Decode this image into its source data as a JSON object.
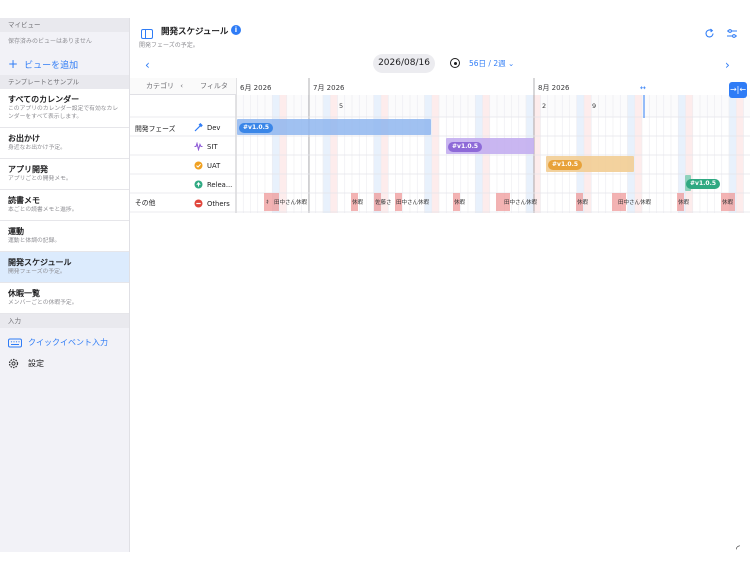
{
  "sidebar": {
    "my_views_header": "マイビュー",
    "no_views": "保存済みのビューはありません",
    "add_view": "ビューを追加",
    "templates_header": "テンプレートとサンプル",
    "items": [
      {
        "title": "すべてのカレンダー",
        "desc": "このアプリのカレンダー設定で有効なカレンダーをすべて表示します。"
      },
      {
        "title": "お出かけ",
        "desc": "身近なお出かけ予定。"
      },
      {
        "title": "アプリ開発",
        "desc": "アプリごとの開発メモ。"
      },
      {
        "title": "読書メモ",
        "desc": "本ごとの読書メモと進捗。"
      },
      {
        "title": "運動",
        "desc": "運動と体調の記録。"
      },
      {
        "title": "開発スケジュール",
        "desc": "開発フェーズの予定。"
      },
      {
        "title": "休暇一覧",
        "desc": "メンバーごとの休暇予定。"
      }
    ],
    "input_header": "入力",
    "quick_event": "クイックイベント入力",
    "settings": "設定"
  },
  "header": {
    "title": "開発スケジュール",
    "subtitle": "開発フェーズの予定。",
    "date": "2026/08/16",
    "range": "56日 / 2週 ⌄"
  },
  "grid": {
    "col_category": "カテゴリ",
    "col_filter": "フィルタ",
    "months": [
      "6月 2026",
      "7月 2026",
      "8月 2026"
    ],
    "day_labels": [
      "5",
      "2",
      "9"
    ],
    "cat_dev_phase": "開発フェーズ",
    "cat_other": "その他",
    "filters": [
      "Dev",
      "SIT",
      "UAT",
      "Relea...",
      "Others"
    ],
    "tags": {
      "dev": "#v1.0.5",
      "sit": "#v1.0.5",
      "uat": "#v1.0.5",
      "release": "#v1.0.5"
    },
    "vacations": [
      "休暇",
      "田中さん休暇",
      "休暇",
      "佐藤さ",
      "田中さん休暇",
      "休暇",
      "田中さん休暇",
      "休暇",
      "田中さん休暇",
      "休暇",
      "休暇"
    ]
  },
  "colors": {
    "accent": "#2f7cf6",
    "dev": "#8fb6ee",
    "sit": "#c3aef0",
    "uat": "#f2cd94",
    "release": "#58c09e",
    "vacation": "#ef9a9a"
  }
}
